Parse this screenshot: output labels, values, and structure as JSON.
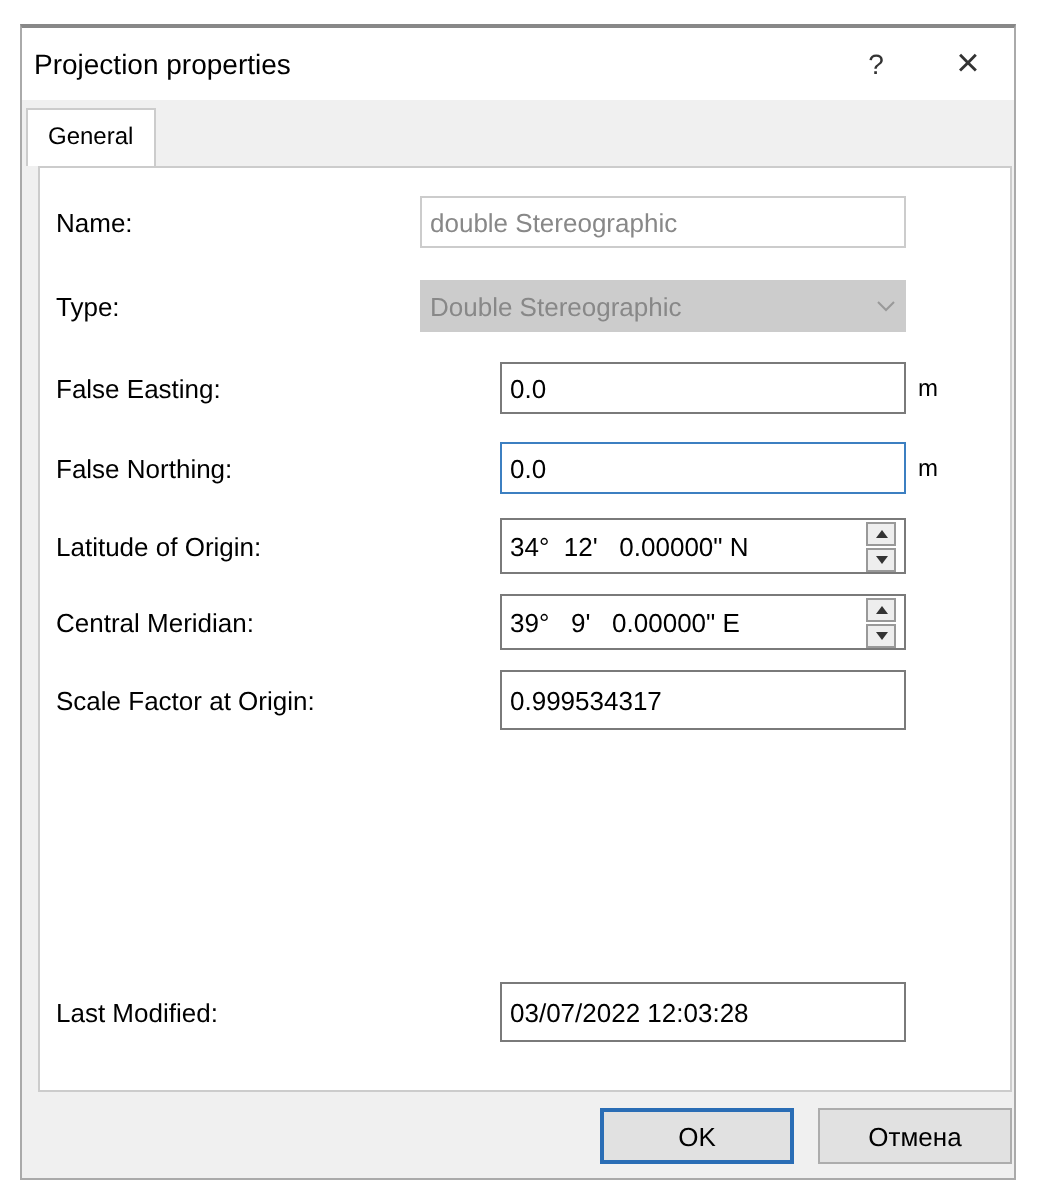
{
  "window": {
    "title": "Projection properties",
    "help": "?",
    "close": "×"
  },
  "tabs": [
    {
      "label": "General",
      "selected": true
    }
  ],
  "fields": [
    {
      "label": "Name:",
      "kind": "text",
      "value": "double Stereographic",
      "disabled": true,
      "focused": false
    },
    {
      "label": "Type:",
      "kind": "combo",
      "value": "Double Stereographic",
      "disabled": true,
      "focused": false
    },
    {
      "label": "False Easting:",
      "kind": "unit",
      "value": "0.0",
      "unit": "m",
      "disabled": false,
      "focused": false
    },
    {
      "label": "False Northing:",
      "kind": "unit",
      "value": "0.0",
      "unit": "m",
      "disabled": false,
      "focused": true
    },
    {
      "label": "Latitude of Origin:",
      "kind": "spin",
      "value": "34°  12'   0.00000\" N",
      "disabled": false,
      "focused": false
    },
    {
      "label": "Central Meridian:",
      "kind": "spin",
      "value": "39°   9'   0.00000\" E",
      "disabled": false,
      "focused": false
    },
    {
      "label": "Scale Factor at Origin:",
      "kind": "plain",
      "value": "0.999534317",
      "disabled": false,
      "focused": false
    }
  ],
  "last_modified": {
    "label": "Last Modified:",
    "value": "03/07/2022 12:03:28"
  },
  "buttons": [
    {
      "label": "OK",
      "default": true
    },
    {
      "label": "Отмена",
      "default": false
    }
  ]
}
